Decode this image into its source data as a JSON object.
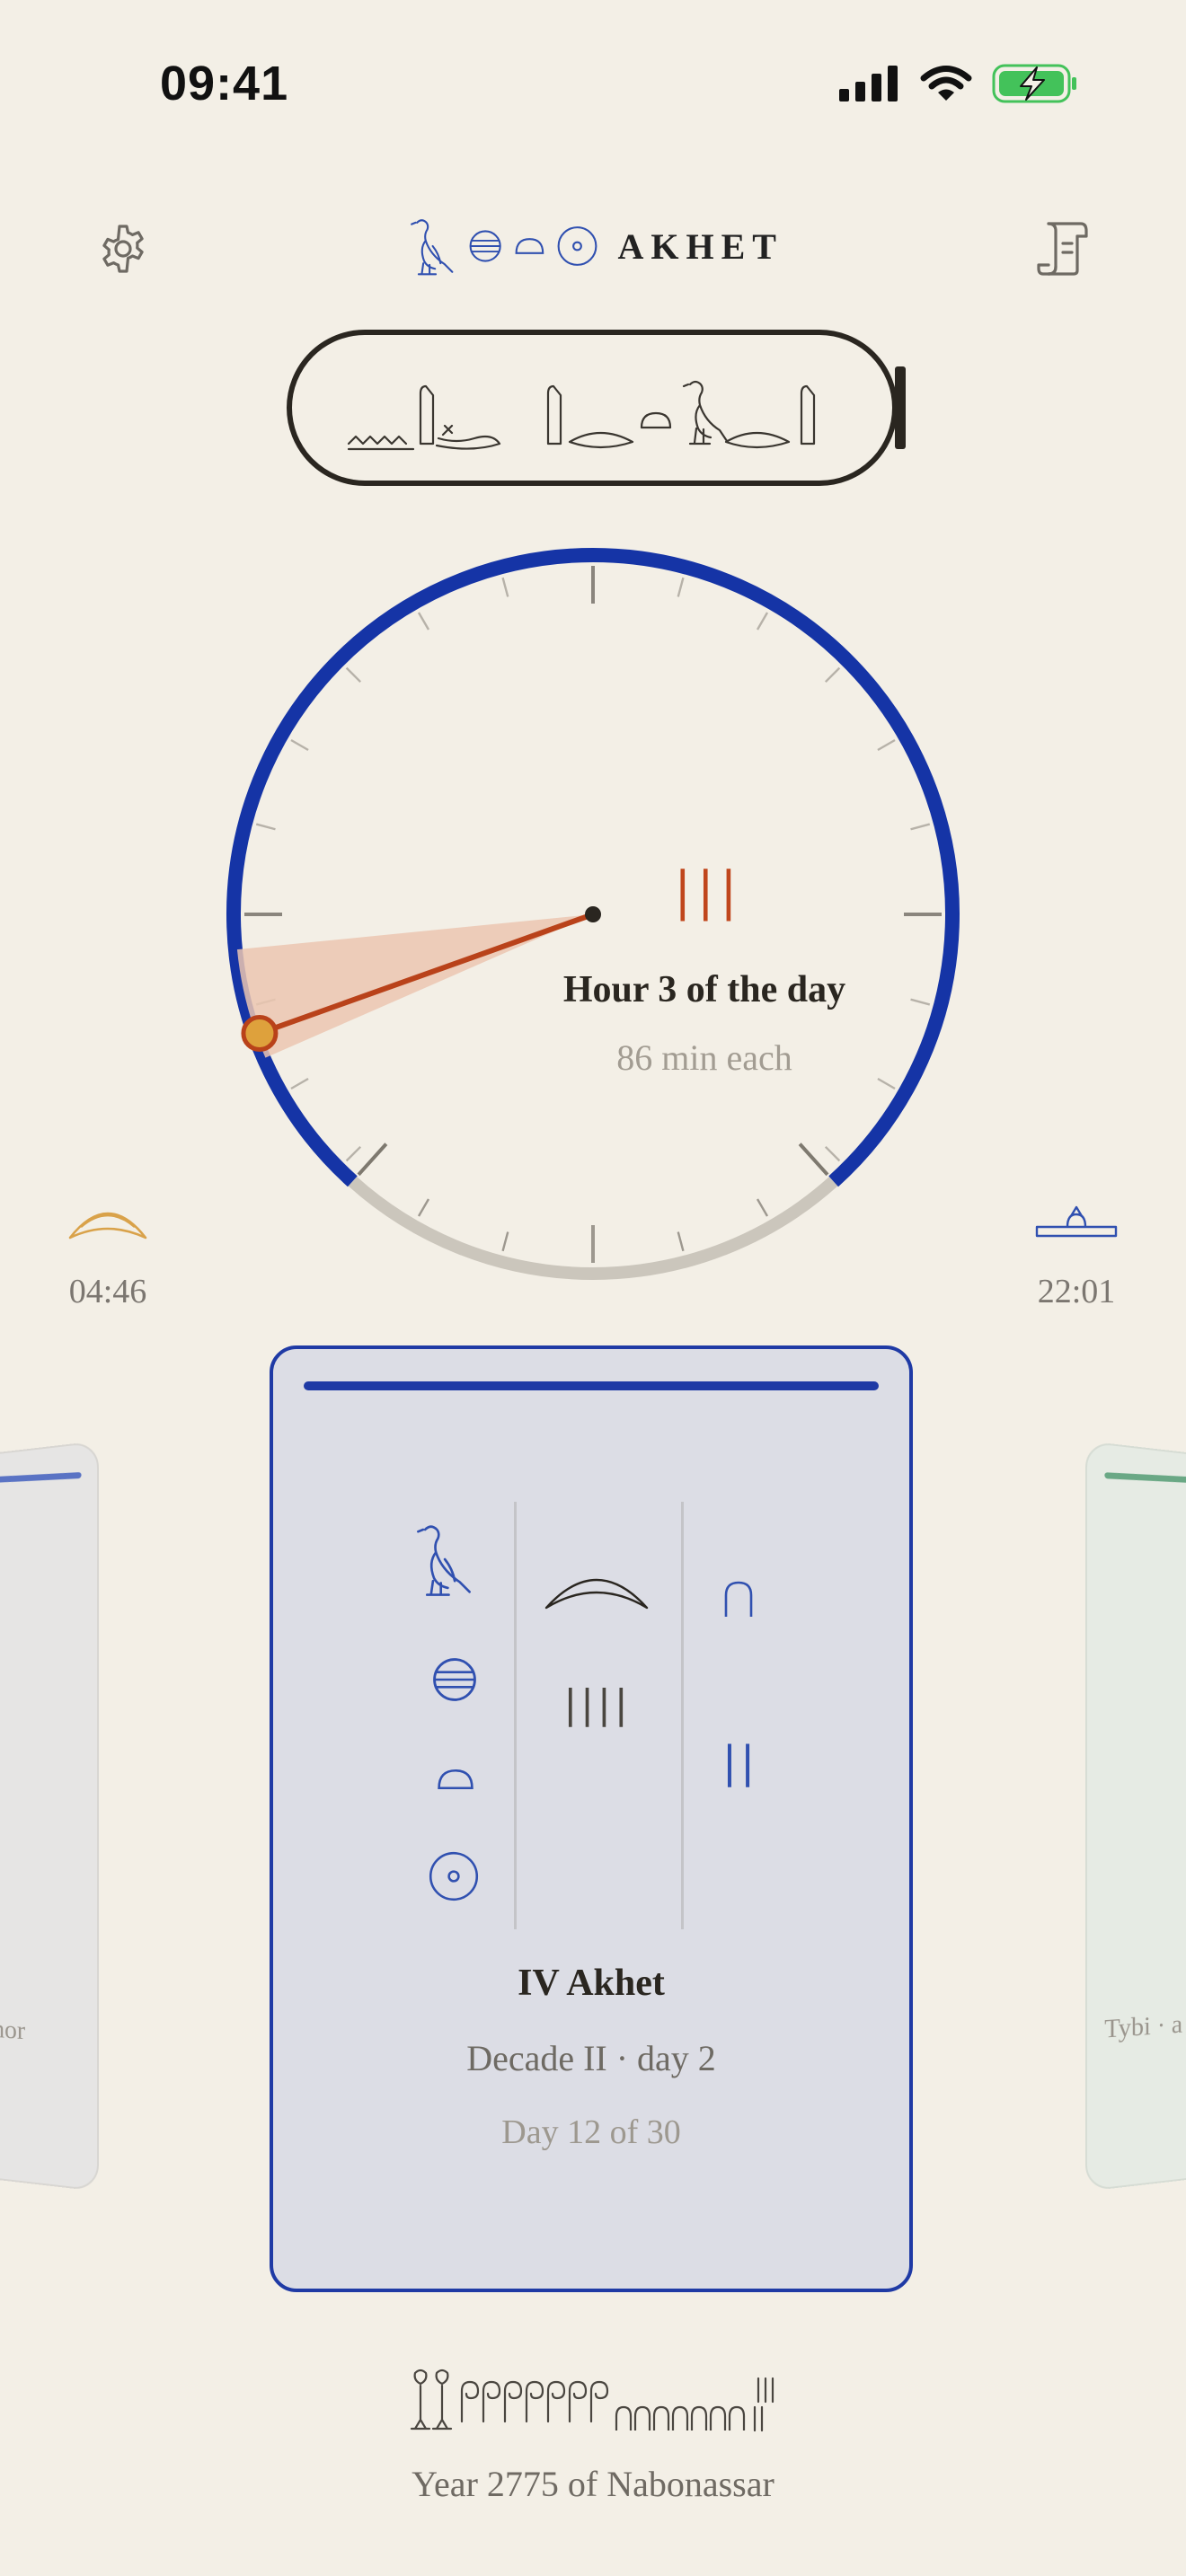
{
  "status_bar": {
    "time": "09:41",
    "icons": [
      "cellular-signal-icon",
      "wifi-icon",
      "battery-charging-icon"
    ]
  },
  "header": {
    "title": "AKHET",
    "left_icon": "gear-icon",
    "right_icon": "scroll-icon"
  },
  "dial": {
    "hour_glyph": "|||",
    "label": "Hour 3 of the day",
    "sublabel": "86 min each",
    "day_fraction_hand": 0.3,
    "colors": {
      "day_arc": "#1534a6",
      "night_arc": "#cbc6bc",
      "hand": "#b9421a",
      "sector": "#ebc6b0",
      "knob": "#dea13c"
    }
  },
  "sunrise": {
    "time": "04:46",
    "icon": "sunrise-icon"
  },
  "sunset": {
    "time": "22:01",
    "icon": "sunset-icon"
  },
  "current_card": {
    "title": "IV Akhet",
    "subtitle": "Decade II · day 2",
    "day_line": "Day 12 of 30",
    "accent": "#1f3aa5",
    "month_strokes": "||||",
    "decade_strokes": "||"
  },
  "prev_card": {
    "label": "athor",
    "accent": "#5a73c4"
  },
  "next_card": {
    "label": "Tybi · a",
    "accent": "#6aa885"
  },
  "footer": {
    "label": "Year 2775 of Nabonassar"
  }
}
